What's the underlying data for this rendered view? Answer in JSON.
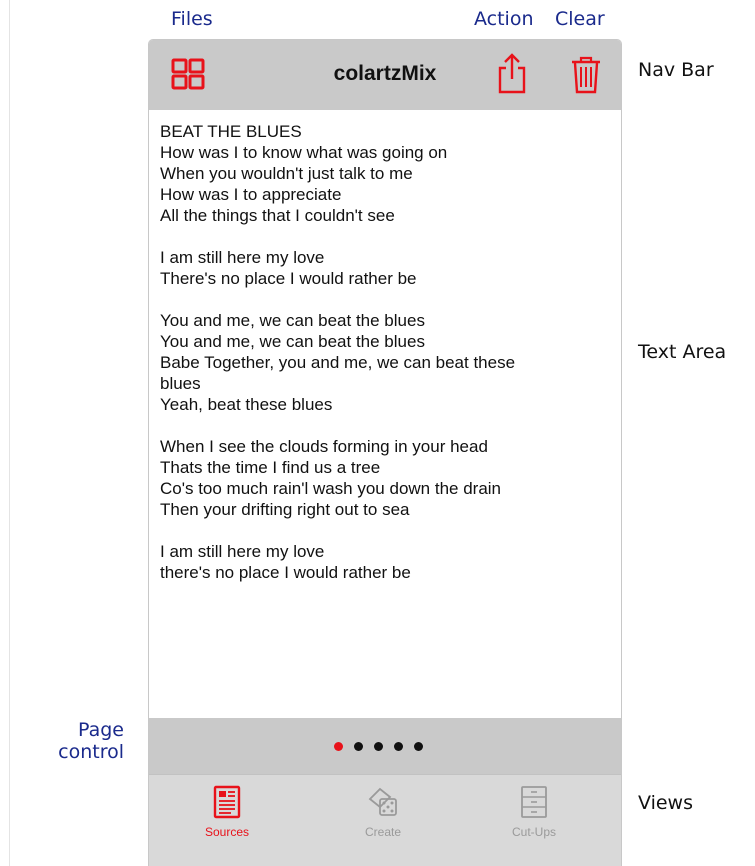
{
  "callouts": {
    "files": "Files",
    "action": "Action",
    "clear": "Clear",
    "nav_bar": "Nav Bar",
    "text_area": "Text Area",
    "page_control_line1": "Page",
    "page_control_line2": "control",
    "views": "Views"
  },
  "nav": {
    "title": "colartzMix",
    "files_icon": "grid-icon",
    "action_icon": "share-icon",
    "clear_icon": "trash-icon"
  },
  "lyrics": [
    "BEAT THE BLUES",
    "How was I to know what was going on",
    "When you wouldn't just talk to me",
    "How was I to appreciate",
    "All the things that I couldn't see",
    "",
    "I am still here my love",
    "There's no place I would rather be",
    "",
    "You and me, we can beat the blues",
    "You and me, we can beat the blues",
    "Babe Together, you and me, we can beat these",
    "blues",
    "Yeah, beat these blues",
    "",
    "When I see the clouds forming in your head",
    "Thats the time I find us a tree",
    "Co's too much rain'l wash you down the drain",
    "Then your drifting right out to sea",
    "",
    "I am still here my love",
    "there's no place I would rather be"
  ],
  "page_control": {
    "pages": 5,
    "current": 1
  },
  "tabs": [
    {
      "label": "Sources",
      "icon": "document-icon",
      "selected": true
    },
    {
      "label": "Create",
      "icon": "dice-cup-icon",
      "selected": false
    },
    {
      "label": "Cut-Ups",
      "icon": "drawers-icon",
      "selected": false
    }
  ],
  "colors": {
    "accent": "#e8121a",
    "nav_bg": "#c9c9c9",
    "tab_bg": "#d9d9d9",
    "callout_blue": "#1a2a8c",
    "inactive": "#9a9a9a"
  }
}
